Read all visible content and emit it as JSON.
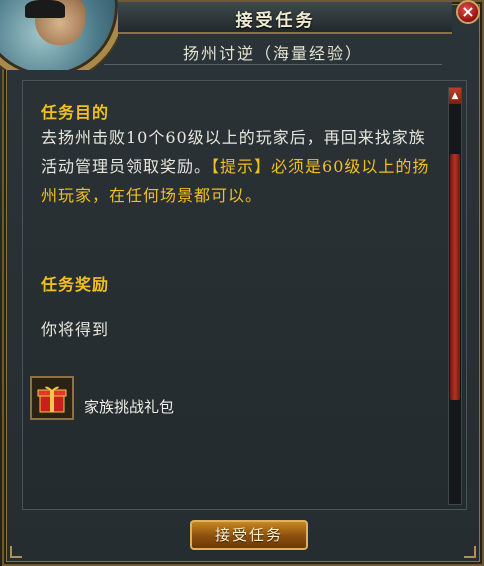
{
  "window": {
    "title": "接受任务",
    "close_label": "×"
  },
  "quest": {
    "name": "扬州讨逆（海量经验）",
    "objective_heading": "任务目的",
    "objective_text": "去扬州击败10个60级以上的玩家后，再回来找家族活动管理员领取奖励。",
    "hint_text": "【提示】必须是60级以上的扬州玩家，在任何场景都可以。",
    "reward_heading": "任务奖励",
    "reward_intro": "你将得到",
    "rewards": [
      {
        "name": "家族挑战礼包",
        "icon": "gift-box-icon"
      }
    ]
  },
  "actions": {
    "accept_label": "接受任务"
  },
  "scrollbar": {
    "up_arrow": "▲"
  },
  "colors": {
    "highlight_yellow": "#f0c020",
    "body_white": "#e8e6dc",
    "accent_red": "#b8301f",
    "button_orange": "#c7871f",
    "frame_gold": "#8a7242"
  }
}
